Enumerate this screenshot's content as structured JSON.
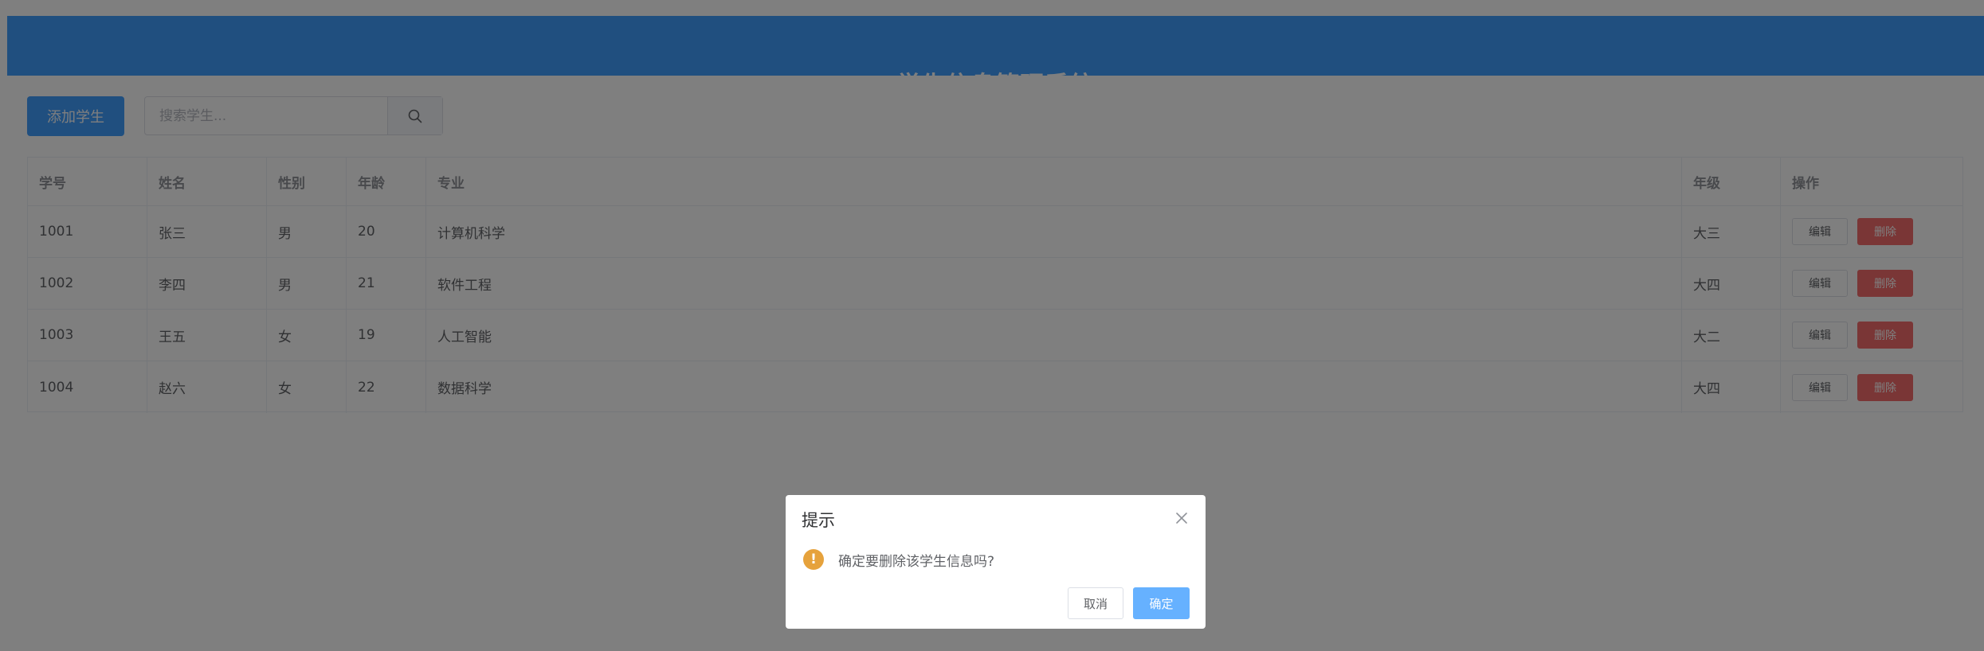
{
  "app": {
    "title": "学生信息管理系统"
  },
  "toolbar": {
    "add_label": "添加学生",
    "search_placeholder": "搜索学生..."
  },
  "table": {
    "columns": [
      "学号",
      "姓名",
      "性别",
      "年龄",
      "专业",
      "年级",
      "操作"
    ],
    "rows": [
      [
        "1001",
        "张三",
        "男",
        "20",
        "计算机科学",
        "大三"
      ],
      [
        "1002",
        "李四",
        "男",
        "21",
        "软件工程",
        "大四"
      ],
      [
        "1003",
        "王五",
        "女",
        "19",
        "人工智能",
        "大二"
      ],
      [
        "1004",
        "赵六",
        "女",
        "22",
        "数据科学",
        "大四"
      ]
    ],
    "edit_label": "编辑",
    "delete_label": "删除"
  },
  "dialog": {
    "title": "提示",
    "message": "确定要删除该学生信息吗?",
    "cancel_label": "取消",
    "confirm_label": "确定",
    "icon": "warning-icon",
    "icon_glyph": "!"
  },
  "colors": {
    "primary": "#409eff",
    "danger": "#f56c6c",
    "warning": "#e6a23c",
    "confirm_light": "#66b1ff"
  }
}
